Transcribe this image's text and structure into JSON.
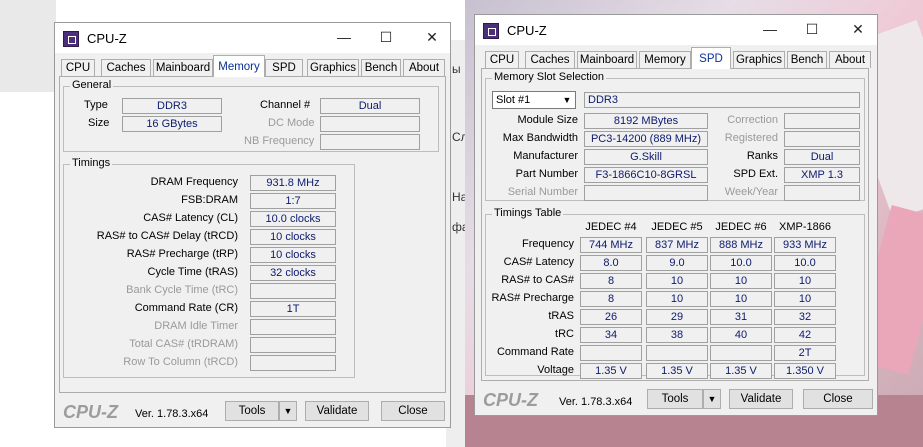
{
  "background": {
    "left_edge_glyphs": [
      "ы",
      "Сл",
      "На",
      "фа"
    ]
  },
  "window_memory": {
    "title": "CPU-Z",
    "controls": {
      "minimize": "—",
      "maximize": "☐",
      "close": "✕"
    },
    "tabs": [
      "CPU",
      "Caches",
      "Mainboard",
      "Memory",
      "SPD",
      "Graphics",
      "Bench",
      "About"
    ],
    "active_tab": "Memory",
    "general": {
      "title": "General",
      "type_label": "Type",
      "type_value": "DDR3",
      "size_label": "Size",
      "size_value": "16 GBytes",
      "channel_label": "Channel #",
      "channel_value": "Dual",
      "dc_mode_label": "DC Mode",
      "dc_mode_value": "",
      "nb_freq_label": "NB Frequency",
      "nb_freq_value": ""
    },
    "timings": {
      "title": "Timings",
      "rows": [
        {
          "label": "DRAM Frequency",
          "value": "931.8 MHz",
          "dim": false
        },
        {
          "label": "FSB:DRAM",
          "value": "1:7",
          "dim": false
        },
        {
          "label": "CAS# Latency (CL)",
          "value": "10.0 clocks",
          "dim": false
        },
        {
          "label": "RAS# to CAS# Delay (tRCD)",
          "value": "10 clocks",
          "dim": false
        },
        {
          "label": "RAS# Precharge (tRP)",
          "value": "10 clocks",
          "dim": false
        },
        {
          "label": "Cycle Time (tRAS)",
          "value": "32 clocks",
          "dim": false
        },
        {
          "label": "Bank Cycle Time (tRC)",
          "value": "",
          "dim": true
        },
        {
          "label": "Command Rate (CR)",
          "value": "1T",
          "dim": false
        },
        {
          "label": "DRAM Idle Timer",
          "value": "",
          "dim": true
        },
        {
          "label": "Total CAS# (tRDRAM)",
          "value": "",
          "dim": true
        },
        {
          "label": "Row To Column (tRCD)",
          "value": "",
          "dim": true
        }
      ]
    },
    "footer": {
      "brand": "CPU-Z",
      "version": "Ver. 1.78.3.x64",
      "tools": "Tools",
      "dropdown": "▼",
      "validate": "Validate",
      "close": "Close"
    }
  },
  "window_spd": {
    "title": "CPU-Z",
    "controls": {
      "minimize": "—",
      "maximize": "☐",
      "close": "✕"
    },
    "tabs": [
      "CPU",
      "Caches",
      "Mainboard",
      "Memory",
      "SPD",
      "Graphics",
      "Bench",
      "About"
    ],
    "active_tab": "SPD",
    "slot": {
      "title": "Memory Slot Selection",
      "slot_value": "Slot #1",
      "slot_arrow": "▼",
      "type_value": "DDR3",
      "module_size_label": "Module Size",
      "module_size_value": "8192 MBytes",
      "max_bw_label": "Max Bandwidth",
      "max_bw_value": "PC3-14200 (889 MHz)",
      "manufacturer_label": "Manufacturer",
      "manufacturer_value": "G.Skill",
      "part_label": "Part Number",
      "part_value": "F3-1866C10-8GRSL",
      "serial_label": "Serial Number",
      "serial_value": "",
      "correction_label": "Correction",
      "correction_value": "",
      "registered_label": "Registered",
      "registered_value": "",
      "ranks_label": "Ranks",
      "ranks_value": "Dual",
      "spd_ext_label": "SPD Ext.",
      "spd_ext_value": "XMP 1.3",
      "week_label": "Week/Year",
      "week_value": ""
    },
    "timings_table": {
      "title": "Timings Table",
      "columns": [
        "JEDEC #4",
        "JEDEC #5",
        "JEDEC #6",
        "XMP-1866"
      ],
      "rows": [
        {
          "label": "Frequency",
          "values": [
            "744 MHz",
            "837 MHz",
            "888 MHz",
            "933 MHz"
          ]
        },
        {
          "label": "CAS# Latency",
          "values": [
            "8.0",
            "9.0",
            "10.0",
            "10.0"
          ]
        },
        {
          "label": "RAS# to CAS#",
          "values": [
            "8",
            "10",
            "10",
            "10"
          ]
        },
        {
          "label": "RAS# Precharge",
          "values": [
            "8",
            "10",
            "10",
            "10"
          ]
        },
        {
          "label": "tRAS",
          "values": [
            "26",
            "29",
            "31",
            "32"
          ]
        },
        {
          "label": "tRC",
          "values": [
            "34",
            "38",
            "40",
            "42"
          ]
        },
        {
          "label": "Command Rate",
          "values": [
            "",
            "",
            "",
            "2T"
          ]
        },
        {
          "label": "Voltage",
          "values": [
            "1.35 V",
            "1.35 V",
            "1.35 V",
            "1.350 V"
          ]
        }
      ]
    },
    "footer": {
      "brand": "CPU-Z",
      "version": "Ver. 1.78.3.x64",
      "tools": "Tools",
      "dropdown": "▼",
      "validate": "Validate",
      "close": "Close"
    }
  }
}
